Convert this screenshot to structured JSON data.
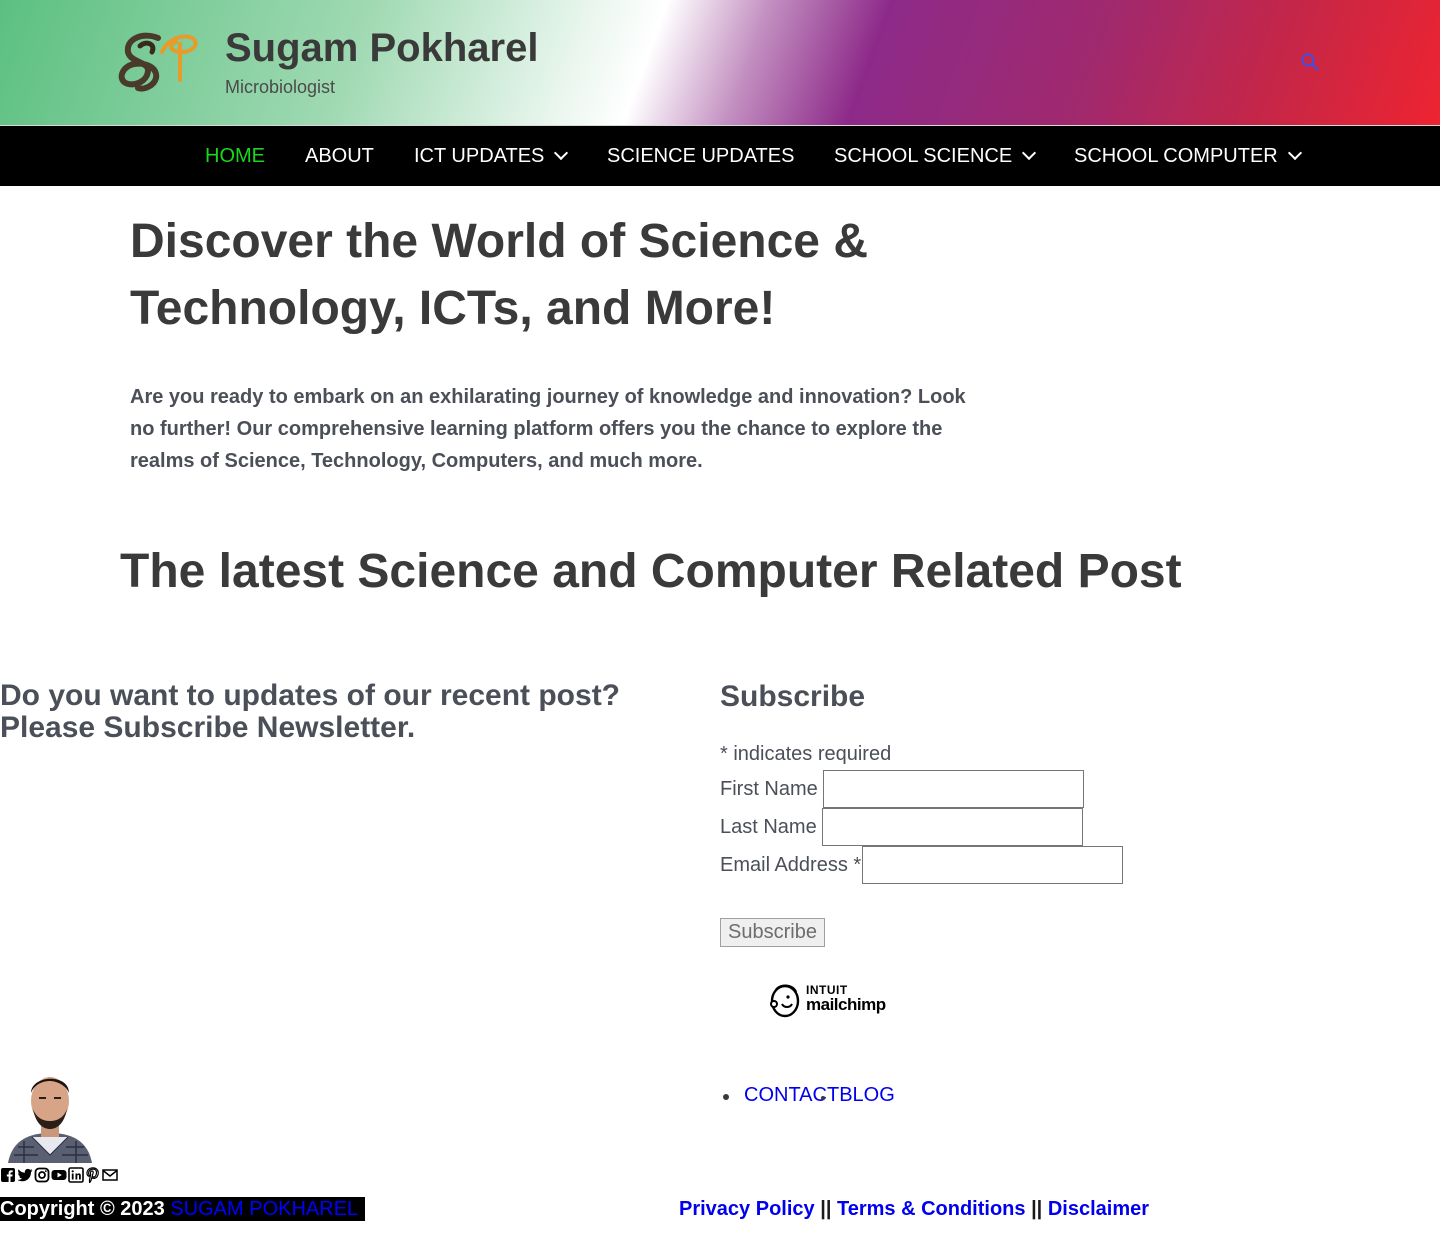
{
  "header": {
    "site_title": "Sugam Pokharel",
    "tagline": "Microbiologist",
    "search_icon": "search-icon",
    "accent_color": "#17d81b"
  },
  "nav": {
    "items": [
      {
        "label": "HOME",
        "active": true,
        "has_dropdown": false
      },
      {
        "label": "ABOUT",
        "active": false,
        "has_dropdown": false
      },
      {
        "label": "ICT UPDATES",
        "active": false,
        "has_dropdown": true
      },
      {
        "label": "SCIENCE UPDATES",
        "active": false,
        "has_dropdown": false
      },
      {
        "label": "SCHOOL SCIENCE",
        "active": false,
        "has_dropdown": true
      },
      {
        "label": "SCHOOL COMPUTER",
        "active": false,
        "has_dropdown": true
      }
    ]
  },
  "hero": {
    "title": "Discover the World of Science & Technology, ICTs, and More!",
    "text": "Are you ready to embark on an exhilarating journey of knowledge and innovation? Look no further! Our comprehensive learning platform offers you the chance to explore the realms of Science, Technology, Computers, and much more."
  },
  "latest": {
    "title": "The latest Science and Computer Related Post"
  },
  "newsletter": {
    "promo": "Do you want to updates of our recent post? Please Subscribe Newsletter.",
    "heading": "Subscribe",
    "required_note": "* indicates required",
    "first_name_label": "First Name",
    "last_name_label": "Last Name",
    "email_label": "Email Address *",
    "first_name_value": "",
    "last_name_value": "",
    "email_value": "",
    "button_label": "Subscribe",
    "badge_line1": "INTUIT",
    "badge_line2": "mailchimp"
  },
  "footer": {
    "links": [
      "CONTACT",
      "BLOG"
    ],
    "social_icons": [
      "facebook-icon",
      "twitter-icon",
      "instagram-icon",
      "youtube-icon",
      "linkedin-icon",
      "pinterest-icon",
      "email-icon"
    ],
    "copyright_prefix": "Copyright © 2023 ",
    "copyright_owner": "SUGAM POKHAREL",
    "policy_links": [
      "Privacy Policy",
      "Terms & Conditions",
      "Disclaimer"
    ],
    "separator": "||"
  }
}
